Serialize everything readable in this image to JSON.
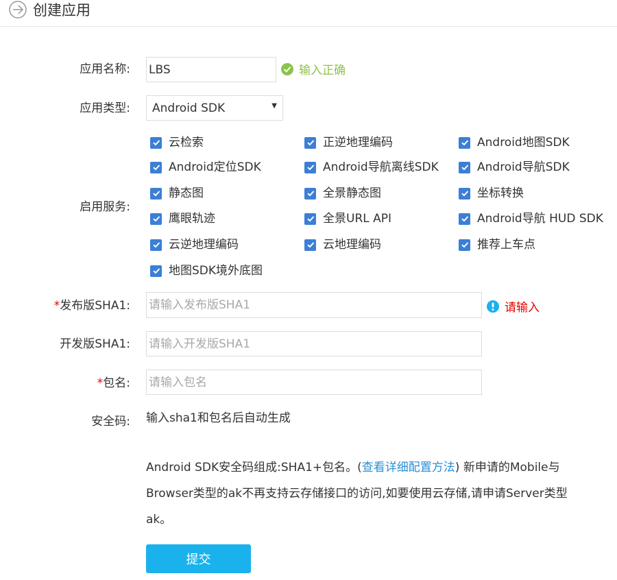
{
  "header": {
    "title": "创建应用"
  },
  "form": {
    "app_name": {
      "label": "应用名称:",
      "value": "LBS",
      "status": "输入正确"
    },
    "app_type": {
      "label": "应用类型:",
      "value": "Android SDK"
    },
    "services": {
      "label": "启用服务:",
      "items": [
        "云检索",
        "正逆地理编码",
        "Android地图SDK",
        "Android定位SDK",
        "Android导航离线SDK",
        "Android导航SDK",
        "静态图",
        "全景静态图",
        "坐标转换",
        "鹰眼轨迹",
        "全景URL API",
        "Android导航 HUD SDK",
        "云逆地理编码",
        "云地理编码",
        "推荐上车点",
        "地图SDK境外底图"
      ]
    },
    "release_sha1": {
      "required_mark": "*",
      "label": "发布版SHA1:",
      "placeholder": "请输入发布版SHA1",
      "error": "请输入"
    },
    "dev_sha1": {
      "label": "开发版SHA1:",
      "placeholder": "请输入开发版SHA1"
    },
    "package_name": {
      "required_mark": "*",
      "label": "包名:",
      "placeholder": "请输入包名"
    },
    "security_code": {
      "label": "安全码:",
      "value": "输入sha1和包名后自动生成"
    },
    "note": {
      "part1": "Android SDK安全码组成:SHA1+包名。(",
      "link": "查看详细配置方法",
      "part2": ") 新申请的Mobile与Browser类型的ak不再支持云存储接口的访问,如要使用云存储,请申请Server类型ak。"
    },
    "submit_label": "提交"
  },
  "colors": {
    "primary": "#1ab2ec",
    "checkbox": "#3b7fd6",
    "success": "#8cc34b",
    "error": "#e60000",
    "link": "#2a8fd6"
  }
}
